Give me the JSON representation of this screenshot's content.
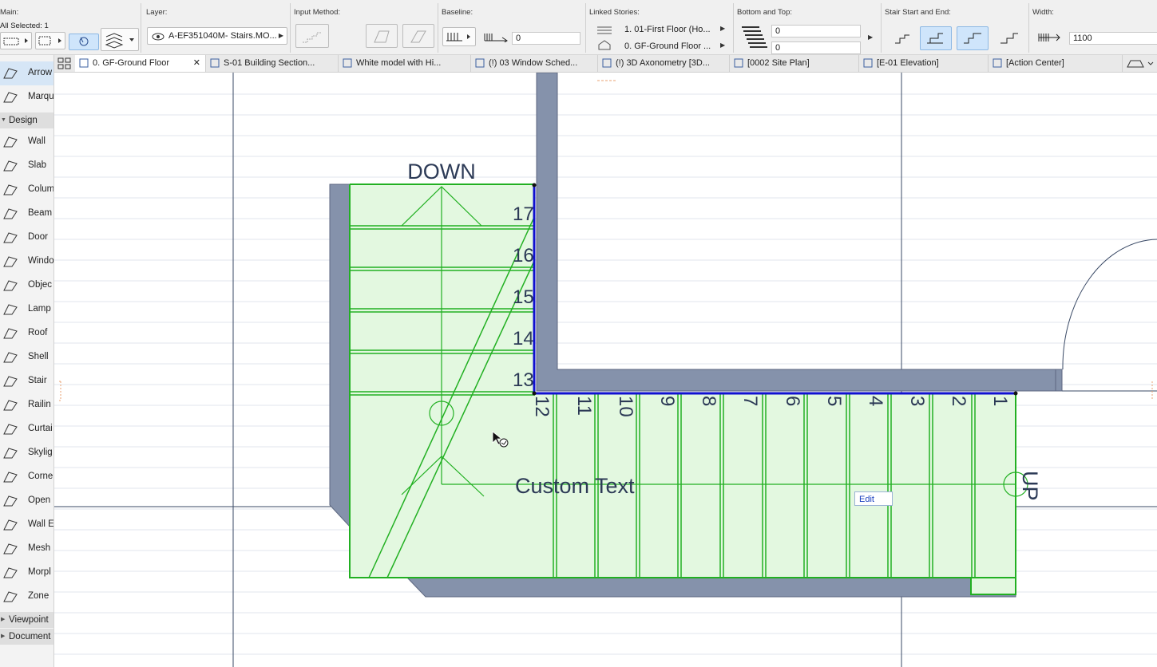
{
  "info_box": {
    "main": {
      "title": "Main:",
      "selection": "All Selected: 1"
    },
    "layer": {
      "title": "Layer:",
      "value": "A-EF351040M- Stairs.MO..."
    },
    "input_method": {
      "title": "Input Method:"
    },
    "baseline": {
      "title": "Baseline:",
      "offset": "0"
    },
    "linked_stories": {
      "title": "Linked Stories:",
      "top": "1. 01-First Floor (Ho...",
      "bottom": "0. GF-Ground Floor ..."
    },
    "bottom_top": {
      "title": "Bottom and Top:",
      "top_value": "0",
      "bottom_value": "0"
    },
    "stair_start_end": {
      "title": "Stair Start and End:"
    },
    "width": {
      "title": "Width:",
      "value": "1100"
    }
  },
  "tabs": [
    {
      "label": "0. GF-Ground Floor",
      "icon": "floor-plan-icon",
      "active": true,
      "close": "✕"
    },
    {
      "label": "S-01 Building Section...",
      "icon": "section-icon"
    },
    {
      "label": "White model with Hi...",
      "icon": "3d-document-icon"
    },
    {
      "label": "(!) 03 Window Sched...",
      "icon": "schedule-icon"
    },
    {
      "label": "(!) 3D Axonometry [3D...",
      "icon": "3d-view-icon"
    },
    {
      "label": "[0002 Site Plan]",
      "icon": "layout-icon"
    },
    {
      "label": "[E-01 Elevation]",
      "icon": "elevation-icon"
    },
    {
      "label": "[Action Center]",
      "icon": "action-center-icon"
    }
  ],
  "toolbox": {
    "select_tools": [
      {
        "label": "Arrow",
        "icon": "arrow-tool-icon",
        "selected": true
      },
      {
        "label": "Marqu",
        "icon": "marquee-tool-icon"
      }
    ],
    "design_header": "Design",
    "design_tools": [
      {
        "label": "Wall",
        "icon": "wall-tool-icon"
      },
      {
        "label": "Slab",
        "icon": "slab-tool-icon"
      },
      {
        "label": "Colum",
        "icon": "column-tool-icon"
      },
      {
        "label": "Beam",
        "icon": "beam-tool-icon"
      },
      {
        "label": "Door",
        "icon": "door-tool-icon"
      },
      {
        "label": "Windo",
        "icon": "window-tool-icon"
      },
      {
        "label": "Objec",
        "icon": "object-tool-icon"
      },
      {
        "label": "Lamp",
        "icon": "lamp-tool-icon"
      },
      {
        "label": "Roof",
        "icon": "roof-tool-icon"
      },
      {
        "label": "Shell",
        "icon": "shell-tool-icon"
      },
      {
        "label": "Stair",
        "icon": "stair-tool-icon"
      },
      {
        "label": "Railin",
        "icon": "railing-tool-icon"
      },
      {
        "label": "Curtai",
        "icon": "curtain-wall-tool-icon"
      },
      {
        "label": "Skylig",
        "icon": "skylight-tool-icon"
      },
      {
        "label": "Corne",
        "icon": "corner-window-tool-icon"
      },
      {
        "label": "Open",
        "icon": "opening-tool-icon"
      },
      {
        "label": "Wall E",
        "icon": "wall-end-tool-icon"
      },
      {
        "label": "Mesh",
        "icon": "mesh-tool-icon"
      },
      {
        "label": "Morpl",
        "icon": "morph-tool-icon"
      },
      {
        "label": "Zone",
        "icon": "zone-tool-icon"
      }
    ],
    "viewpoint_header": "Viewpoint",
    "document_header": "Document"
  },
  "canvas": {
    "label_down": "DOWN",
    "label_up": "UP",
    "custom_text": "Custom Text",
    "edit_label": "Edit",
    "step_numbers": [
      "1",
      "2",
      "3",
      "4",
      "5",
      "6",
      "7",
      "8",
      "9",
      "10",
      "11",
      "12",
      "13",
      "14",
      "15",
      "16",
      "17"
    ],
    "colors": {
      "stair_fill": "#e3f8e0",
      "stair_line": "#22b022",
      "wall": "#8592ab",
      "selection": "#1010d0",
      "text": "#2c3a56"
    }
  }
}
